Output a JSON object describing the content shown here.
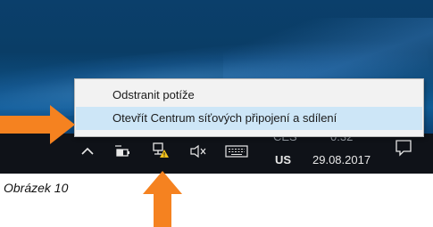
{
  "context_menu": {
    "items": [
      {
        "label": "Odstranit potíže",
        "highlighted": false
      },
      {
        "label": "Otevřít Centrum síťových připojení a sdílení",
        "highlighted": true
      }
    ]
  },
  "taskbar": {
    "language_top": "CES",
    "language": "US",
    "time": "0:32",
    "date": "29.08.2017",
    "icons": [
      "chevron-up-icon",
      "battery-icon",
      "network-warning-icon",
      "speaker-muted-icon",
      "keyboard-icon",
      "notifications-icon"
    ]
  },
  "annotations": {
    "caption": "Obrázek 10",
    "arrow_color": "#f58220"
  }
}
